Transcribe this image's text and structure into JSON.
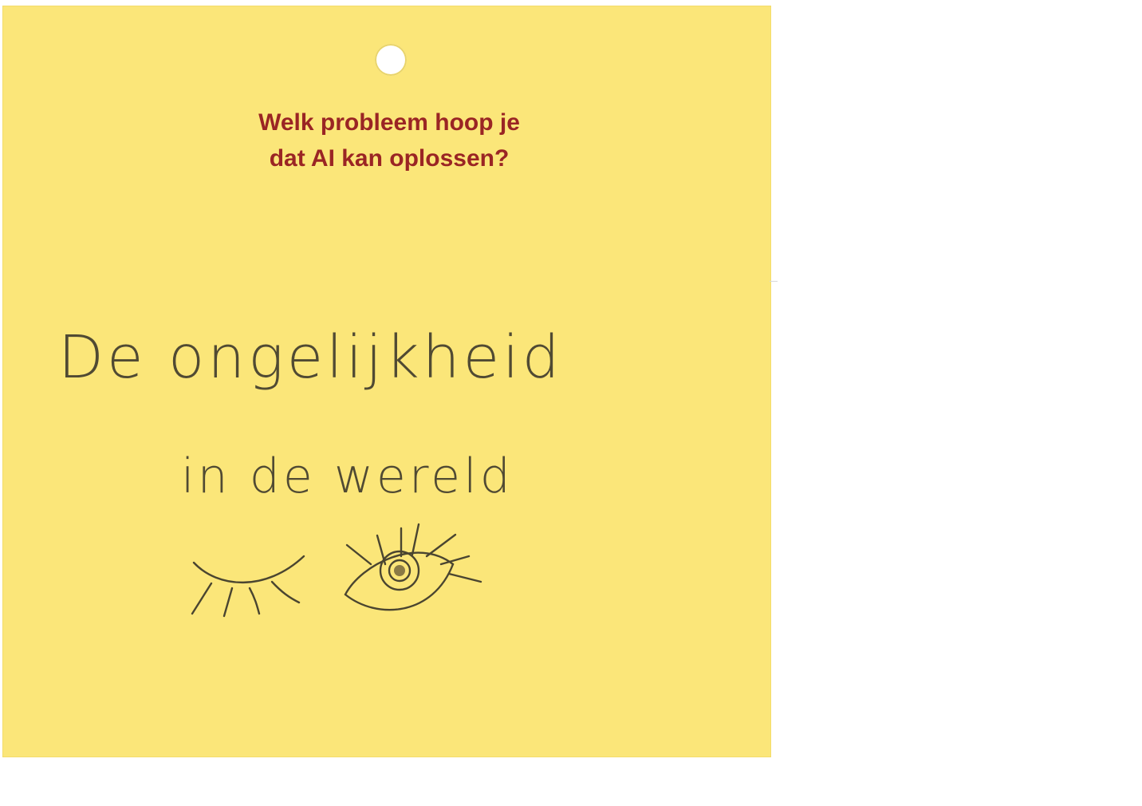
{
  "card": {
    "color": "#fbe679",
    "question_line1": "Welk probleem hoop je",
    "question_line2": "dat AI kan oplossen?",
    "question_color": "#9a2524"
  },
  "handwriting": {
    "line1": "De ongelijkheid",
    "line2": "in de wereld"
  },
  "drawing": {
    "icons": [
      "closed-eye-icon",
      "open-eye-icon"
    ]
  }
}
